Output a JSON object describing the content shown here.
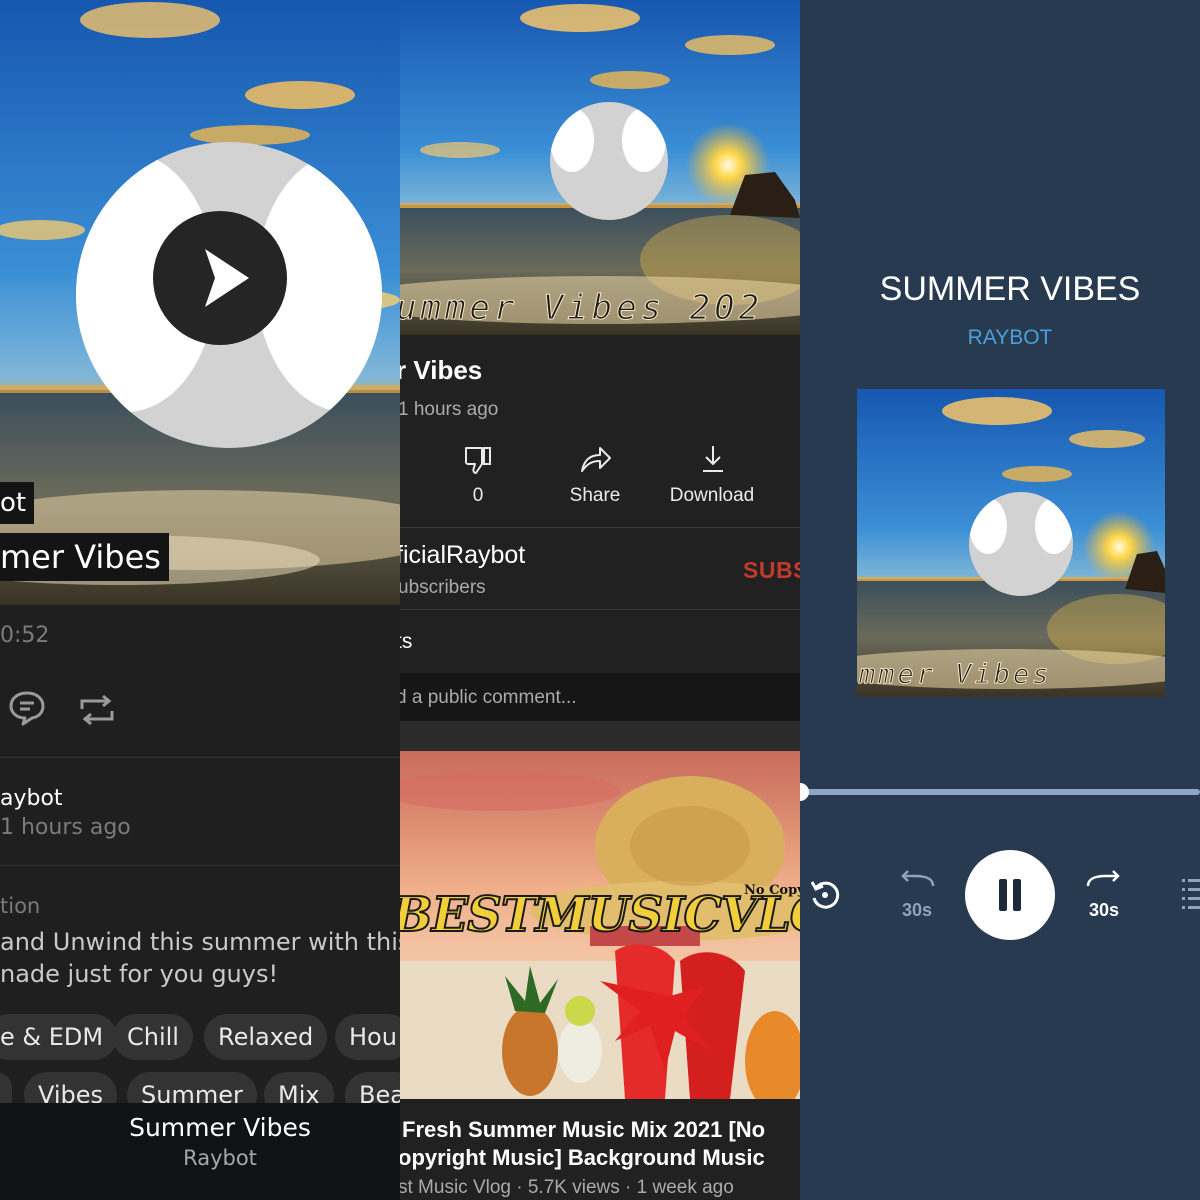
{
  "soundcloud": {
    "artist_tag": "ot",
    "title_tag": "mer Vibes",
    "duration": "0:52",
    "uploader": "aybot",
    "posted": "1 hours ago",
    "description_label": "tion",
    "description_line1": "and Unwind this summer with this",
    "description_line2": "nade just for you guys!",
    "tags_row1": [
      "e & EDM",
      "Chill",
      "Relaxed",
      "Hou"
    ],
    "tags_row2": [
      "",
      "Vibes",
      "Summer",
      "Mix",
      "Bea"
    ],
    "mini_player": {
      "title": "Summer Vibes",
      "artist": "Raybot"
    }
  },
  "youtube": {
    "thumbnail_text": "ummer  Vibes  202",
    "video_title": "r Vibes",
    "posted": "1 hours ago",
    "actions": [
      {
        "icon": "thumbs-down-icon",
        "label": "0"
      },
      {
        "icon": "share-icon",
        "label": "Share"
      },
      {
        "icon": "download-icon",
        "label": "Download"
      }
    ],
    "channel_name": "ficialRaybot",
    "subscribers": "ubscribers",
    "subscribe_label": "SUBS",
    "comments_label": "ts",
    "comment_placeholder": "d a public comment...",
    "next_video": {
      "thumbnail_brand": "BESTMUSICVLO",
      "thumbnail_badge": "No Copyright",
      "title_line1": "Fresh Summer Music Mix 2021 [No",
      "title_line2": "opyright Music] Background Music",
      "meta": "st Music Vlog · 5.7K views · 1 week ago"
    }
  },
  "podcast_player": {
    "title": "SUMMER VIBES",
    "artist": "RAYBOT",
    "art_text": "mmer  Vibes",
    "rewind_label": "30s",
    "forward_label": "30s",
    "progress": 0.0
  },
  "colors": {
    "accent_blue": "#4a9fd8",
    "subscribe_red": "#c0392b",
    "player_bg": "#283a50"
  }
}
